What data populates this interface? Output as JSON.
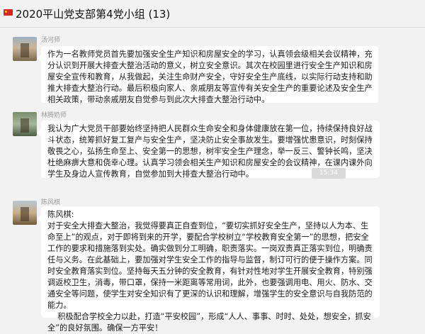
{
  "chat": {
    "title": "2020平山党支部第4党小组 (13)"
  },
  "messages": [
    {
      "sender": "汤河师",
      "text": "作为一名教师党员首先要加强安全生产知识和房屋安全的学习，认真领会级相关会议精神，充分认识到开展大排查大整治活动的意义，树立安全意识。其次在校园里进行安全生产知识和房屋安全宣传和教育，从我做起，关注生命财产安全，守好安全生产底线，以实际行动支持和助推大排查大整治行动。最后积极向家人、亲戚朋友等宣传有关安全生产的重要论述及安全生产相关政策，带动亲戚朋友自觉参与到此次大排查大整治行动中。"
    },
    {
      "sender": "林腾奶师",
      "text": "我认为广大党员干部要始终坚持把人民群众生命安全和身体健康放在第一位，持续保持良好战斗状态，统筹抓好复工复产与安全生产，坚决防止安全事故发生。要增强忧患意识，时刻保持敬畏之心，弘扬生命至上、安全第一的思想，树牢安全生产理念，举一反三、警钟长鸣，坚决杜绝麻痹大意和侥幸心理。认真学习领会相关生产知识和房屋安全的会议精神，在课内课外向学生及身边人宣传教育，自觉参加到大排查大整治行动中。"
    },
    {
      "timestamp": "15:34"
    },
    {
      "sender": "陈风棋",
      "text": "陈风棋:\n对于安全大排查大整治，我觉得要真正自查到位，“要切实抓好安全生产，坚持以人为本、生命至上”的观点，对于即将到来的开学，要配合学校树立“学校教育安全第一”的思想，把安全工作的要求和措施落到实处。确实做到分工明确，职责落实。一岗双责真正落实到位，明确责任与义务。在此基础上，要加强对学生安全工作的指导与监督，制订可行的便于操作方案。同时安全教育落实到位。坚持每天五分钟的安全教育，有针对性地对学生开展安全教育，特别强调返校卫生，消毒，带口罩，保持一米距离等常用词，此外，也要强调用电、用火、防水、交通安全等问题，使学生对安全知识有了更深的认识和理解，增强学生的安全意识与自我防范的能力。\n    积极配合学校全力以赴，打造“平安校园”，形成“人人、事事、时时、处处，想安全，抓安全”的良好氛围。确保一方平安！"
    }
  ]
}
